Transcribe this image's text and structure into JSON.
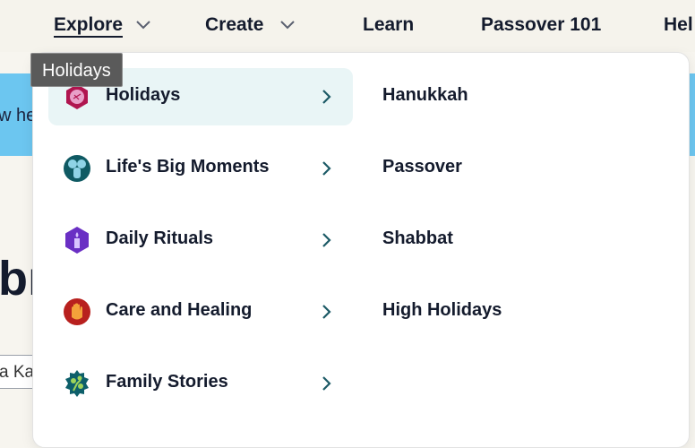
{
  "nav": {
    "items": [
      {
        "label": "Explore",
        "has_dropdown": true,
        "active": true
      },
      {
        "label": "Create",
        "has_dropdown": true,
        "active": false
      },
      {
        "label": "Learn",
        "has_dropdown": false,
        "active": false
      },
      {
        "label": "Passover 101",
        "has_dropdown": false,
        "active": false
      },
      {
        "label": "Hel",
        "has_dropdown": false,
        "active": false
      }
    ]
  },
  "background": {
    "banner_text": "w he",
    "heading_text": "bı",
    "input_value": "a Kac"
  },
  "dropdown": {
    "categories": [
      {
        "label": "Holidays",
        "icon": "pomegranate-icon",
        "icon_color": "#b0154f",
        "highlighted": true
      },
      {
        "label": "Life's Big Moments",
        "icon": "people-icon",
        "icon_color": "#0f5a63",
        "highlighted": false
      },
      {
        "label": "Daily Rituals",
        "icon": "candle-icon",
        "icon_color": "#6a2fc4",
        "highlighted": false
      },
      {
        "label": "Care and Healing",
        "icon": "hamsa-icon",
        "icon_color": "#b8201e",
        "highlighted": false
      },
      {
        "label": "Family Stories",
        "icon": "tree-icon",
        "icon_color": "#0d5f6a",
        "highlighted": false
      }
    ],
    "subitems": [
      "Hanukkah",
      "Passover",
      "Shabbat",
      "High Holidays"
    ]
  },
  "tooltip": {
    "text": "Holidays"
  },
  "colors": {
    "accent_banner": "#6cc6f0",
    "highlight_row": "#e9f5f6",
    "text_dark": "#141b2d",
    "tooltip_bg": "#5a5a5a"
  }
}
